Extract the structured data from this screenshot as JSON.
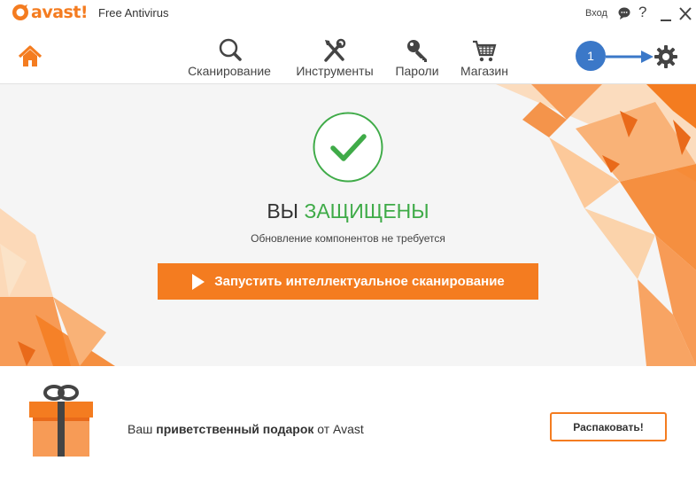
{
  "app": {
    "logo_text": "avast!",
    "product_name": "Free Antivirus",
    "brand_color": "#f47c20"
  },
  "titlebar": {
    "login_label": "Вход",
    "help_label": "?"
  },
  "nav": {
    "items": [
      {
        "label": "Сканирование",
        "icon": "magnifier-icon"
      },
      {
        "label": "Инструменты",
        "icon": "tools-icon"
      },
      {
        "label": "Пароли",
        "icon": "key-icon"
      },
      {
        "label": "Магазин",
        "icon": "cart-icon"
      }
    ]
  },
  "annotation": {
    "step_number": "1",
    "color": "#3b78c8"
  },
  "hero": {
    "status_prefix": "ВЫ",
    "status_highlight": "ЗАЩИЩЕНЫ",
    "status_color": "#3fab48",
    "subtitle": "Обновление компонентов не требуется",
    "scan_button": "Запустить интеллектуальное сканирование"
  },
  "gift": {
    "text_prefix": "Ваш",
    "text_bold": "приветственный подарок",
    "text_suffix": "от Avast",
    "button": "Распаковать!"
  }
}
